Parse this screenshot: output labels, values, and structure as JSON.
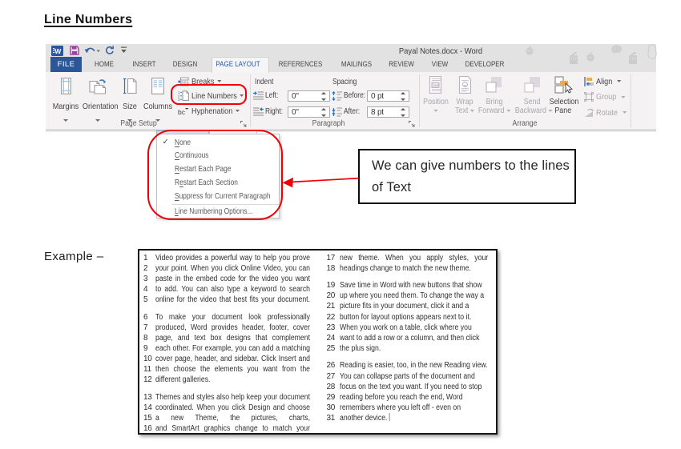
{
  "page": {
    "title": "Line Numbers",
    "example_label": "Example –"
  },
  "window": {
    "title": "Payal Notes.docx - Word",
    "tabs": [
      {
        "label": "FILE",
        "active": false
      },
      {
        "label": "HOME",
        "active": false
      },
      {
        "label": "INSERT",
        "active": false
      },
      {
        "label": "DESIGN",
        "active": false
      },
      {
        "label": "PAGE LAYOUT",
        "active": true
      },
      {
        "label": "REFERENCES",
        "active": false
      },
      {
        "label": "MAILINGS",
        "active": false
      },
      {
        "label": "REVIEW",
        "active": false
      },
      {
        "label": "VIEW",
        "active": false
      },
      {
        "label": "DEVELOPER",
        "active": false
      }
    ],
    "ribbon": {
      "page_setup": {
        "label": "Page Setup",
        "big_buttons": [
          "Margins",
          "Orientation",
          "Size",
          "Columns"
        ],
        "menu_buttons": [
          "Breaks",
          "Line Numbers",
          "Hyphenation"
        ]
      },
      "paragraph": {
        "label": "Paragraph",
        "indent_label": "Indent",
        "spacing_label": "Spacing",
        "fields": [
          {
            "label": "Left:",
            "value": "0\""
          },
          {
            "label": "Right:",
            "value": "0\""
          },
          {
            "label": "Before:",
            "value": "0 pt"
          },
          {
            "label": "After:",
            "value": "8 pt"
          }
        ]
      },
      "arrange": {
        "label": "Arrange",
        "buttons": [
          {
            "line1": "Position",
            "line2": "",
            "enabled": false
          },
          {
            "line1": "Wrap",
            "line2": "Text",
            "enabled": false
          },
          {
            "line1": "Bring",
            "line2": "Forward",
            "enabled": false
          },
          {
            "line1": "Send",
            "line2": "Backward",
            "enabled": false
          },
          {
            "line1": "Selection",
            "line2": "Pane",
            "enabled": true
          }
        ],
        "stack_buttons": [
          {
            "label": "Align",
            "enabled": true
          },
          {
            "label": "Group",
            "enabled": false
          },
          {
            "label": "Rotate",
            "enabled": false
          }
        ]
      }
    }
  },
  "menu": {
    "items": [
      {
        "label": "None",
        "accel": 0,
        "checked": true
      },
      {
        "label": "Continuous",
        "accel": 0,
        "checked": false
      },
      {
        "label": "Restart Each Page",
        "accel": 0,
        "checked": false
      },
      {
        "label": "Restart Each Section",
        "accel": 1,
        "checked": false
      },
      {
        "label": "Suppress for Current Paragraph",
        "accel": 0,
        "checked": false
      },
      {
        "label": "Line Numbering Options...",
        "accel": 0,
        "checked": false
      }
    ]
  },
  "callout": {
    "text": "We can give numbers to the lines of Text"
  },
  "example": {
    "left_lines": [
      {
        "n": "1",
        "text": "Video provides a powerful way to help you prove",
        "justify": true,
        "gap": false
      },
      {
        "n": "2",
        "text": "your point. When you click Online Video, you can",
        "justify": true,
        "gap": false
      },
      {
        "n": "3",
        "text": "paste in the embed code for the video you want",
        "justify": true,
        "gap": false
      },
      {
        "n": "4",
        "text": "to add. You can also type a keyword to search",
        "justify": true,
        "gap": false
      },
      {
        "n": "5",
        "text": "online for the video that best fits your document.",
        "justify": true,
        "gap": false
      },
      {
        "n": "6",
        "text": "To make your document look professionally",
        "justify": true,
        "gap": true
      },
      {
        "n": "7",
        "text": "produced, Word provides header, footer, cover",
        "justify": true,
        "gap": false
      },
      {
        "n": "8",
        "text": "page, and text box designs that complement",
        "justify": true,
        "gap": false
      },
      {
        "n": "9",
        "text": "each other. For example, you can add a matching",
        "justify": true,
        "gap": false
      },
      {
        "n": "10",
        "text": "cover page, header, and sidebar. Click Insert and",
        "justify": true,
        "gap": false
      },
      {
        "n": "11",
        "text": "then choose the elements you want from the",
        "justify": true,
        "gap": false
      },
      {
        "n": "12",
        "text": "different galleries.",
        "justify": false,
        "gap": false
      },
      {
        "n": "13",
        "text": "Themes and styles also help keep your document",
        "justify": true,
        "gap": true
      },
      {
        "n": "14",
        "text": "coordinated. When you click Design and choose",
        "justify": true,
        "gap": false
      },
      {
        "n": "15",
        "text": "a new Theme, the pictures, charts,",
        "justify": true,
        "gap": false
      },
      {
        "n": "16",
        "text": "and SmartArt graphics change to match your",
        "justify": true,
        "gap": false
      }
    ],
    "right_lines": [
      {
        "n": "17",
        "text": "new theme. When you apply styles, your",
        "justify": true,
        "gap": false
      },
      {
        "n": "18",
        "text": "headings change to match the new theme.",
        "justify": false,
        "gap": false
      },
      {
        "n": "19",
        "text": "Save time in Word with new buttons that show",
        "justify": false,
        "gap": true
      },
      {
        "n": "20",
        "text": "up where you need them. To change the way a",
        "justify": false,
        "gap": false
      },
      {
        "n": "21",
        "text": "picture fits in your document, click it and a",
        "justify": false,
        "gap": false
      },
      {
        "n": "22",
        "text": "button for layout options appears next to it.",
        "justify": false,
        "gap": false
      },
      {
        "n": "23",
        "text": "When you work on a table, click where you",
        "justify": false,
        "gap": false
      },
      {
        "n": "24",
        "text": "want to add a row or a column, and then click",
        "justify": false,
        "gap": false
      },
      {
        "n": "25",
        "text": "the plus sign.",
        "justify": false,
        "gap": false
      },
      {
        "n": "26",
        "text": "Reading is easier, too, in the new Reading view.",
        "justify": false,
        "gap": true
      },
      {
        "n": "27",
        "text": "You can collapse parts of the document and",
        "justify": false,
        "gap": false
      },
      {
        "n": "28",
        "text": "focus on the text you want. If you need to stop",
        "justify": false,
        "gap": false
      },
      {
        "n": "29",
        "text": "reading before you reach the end, Word",
        "justify": false,
        "gap": false
      },
      {
        "n": "30",
        "text": "remembers where you left off - even on",
        "justify": false,
        "gap": false
      },
      {
        "n": "31",
        "text": "another device.",
        "justify": false,
        "gap": false,
        "cursor": true
      }
    ]
  },
  "colors": {
    "accent_blue": "#2b579a",
    "annotation_red": "#f00005",
    "titlebar_grey": "#e2e2e2",
    "ribbon_grey": "#f4f2f3"
  }
}
